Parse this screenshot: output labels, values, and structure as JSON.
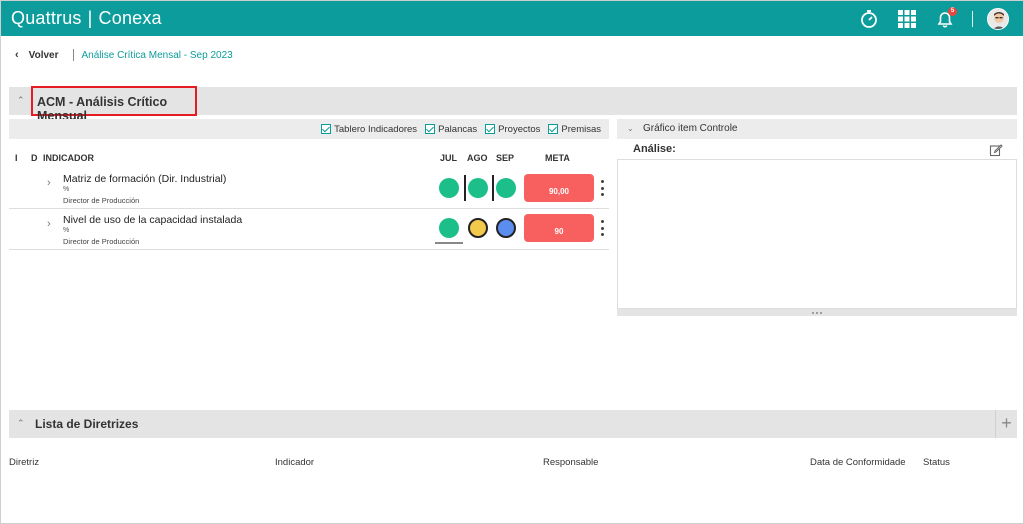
{
  "app": {
    "brand": "Quattrus",
    "product": "Conexa",
    "separator": "|"
  },
  "topbar": {
    "timer_icon": "stopwatch-icon",
    "apps_icon": "grid-icon",
    "bell_icon": "bell-icon",
    "notifications_count": "5",
    "avatar_icon": "user-avatar"
  },
  "breadcrumb": {
    "back_label": "Volver",
    "current": "Análise Crítica Mensal - Sep 2023"
  },
  "acm": {
    "title": "ACM - Análisis Crítico Mensual"
  },
  "filters": [
    {
      "label": "Tablero Indicadores",
      "checked": true
    },
    {
      "label": "Palancas",
      "checked": true
    },
    {
      "label": "Proyectos",
      "checked": true
    },
    {
      "label": "Premisas",
      "checked": true
    }
  ],
  "table": {
    "headers": {
      "i": "I",
      "d": "D",
      "indicador": "INDICADOR",
      "jul": "JUL",
      "ago": "AGO",
      "sep": "SEP",
      "meta": "META"
    },
    "rows": [
      {
        "name": "Matriz de formación (Dir. Industrial)",
        "unit": "%",
        "owner": "Director de Producción",
        "months": [
          "#1cbf8a",
          "#1cbf8a",
          "#1cbf8a"
        ],
        "meta": "90,00"
      },
      {
        "name": "Nivel de uso de la capacidad instalada",
        "unit": "%",
        "owner": "Director de Producción",
        "months": [
          "#1cbf8a",
          "#f2c94c",
          "#5b8def"
        ],
        "meta": "90"
      }
    ]
  },
  "grafico": {
    "title": "Gráfico item Controle",
    "analise_label": "Análise:"
  },
  "lista": {
    "title": "Lista de Diretrizes",
    "add": "+",
    "columns": [
      "Diretriz",
      "Indicador",
      "Responsable",
      "Data de Conformidade",
      "Status"
    ]
  },
  "colors": {
    "brand": "#0d9c9c",
    "meta_bg": "#f86060",
    "green": "#1cbf8a",
    "yellow": "#f2c94c",
    "blue": "#5b8def"
  }
}
